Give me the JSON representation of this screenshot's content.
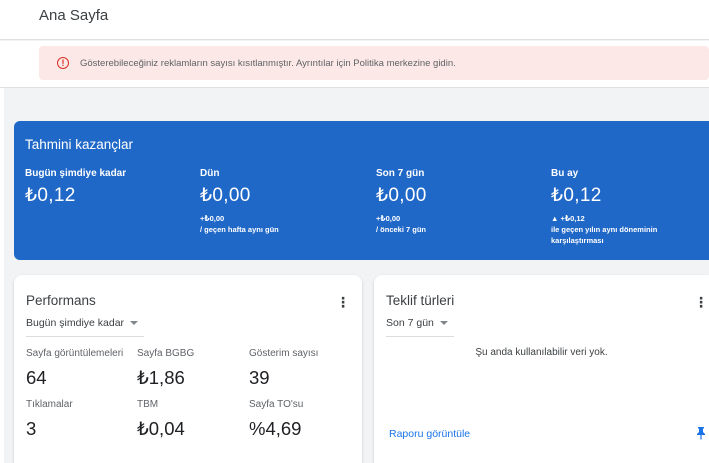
{
  "header": {
    "title": "Ana Sayfa"
  },
  "alert": {
    "icon": "error-icon",
    "text": "Gösterebileceğiniz reklamların sayısı kısıtlanmıştır. Ayrıntılar için Politika merkezine gidin."
  },
  "earnings": {
    "title": "Tahmini kazançlar",
    "columns": [
      {
        "label": "Bugün şimdiye kadar",
        "value": "₺0,12",
        "delta": "",
        "compare": ""
      },
      {
        "label": "Dün",
        "value": "₺0,00",
        "delta": "+₺0,00",
        "compare": "/ geçen hafta aynı gün"
      },
      {
        "label": "Son 7 gün",
        "value": "₺0,00",
        "delta": "+₺0,00",
        "compare": "/ önceki 7 gün"
      },
      {
        "label": "Bu ay",
        "value": "₺0,12",
        "delta": "▲ +₺0,12",
        "compare": "ile geçen yılın aynı döneminin karşılaştırması"
      }
    ]
  },
  "performance": {
    "title": "Performans",
    "range": "Bugün şimdiye kadar",
    "metrics": [
      {
        "label": "Sayfa görüntülemeleri",
        "value": "64"
      },
      {
        "label": "Sayfa BGBG",
        "value": "₺1,86"
      },
      {
        "label": "Gösterim sayısı",
        "value": "39"
      },
      {
        "label": "Tıklamalar",
        "value": "3"
      },
      {
        "label": "TBM",
        "value": "₺0,04"
      },
      {
        "label": "Sayfa TO'su",
        "value": "%4,69"
      }
    ]
  },
  "bid_types": {
    "title": "Teklif türleri",
    "range": "Son 7 gün",
    "empty_text": "Şu anda kullanılabilir veri yok.",
    "report_link": "Raporu görüntüle"
  },
  "colors": {
    "earnings_bg": "#2068c7",
    "link": "#1a73e8",
    "alert_bg": "#fce8e6",
    "alert_icon": "#d93025"
  }
}
